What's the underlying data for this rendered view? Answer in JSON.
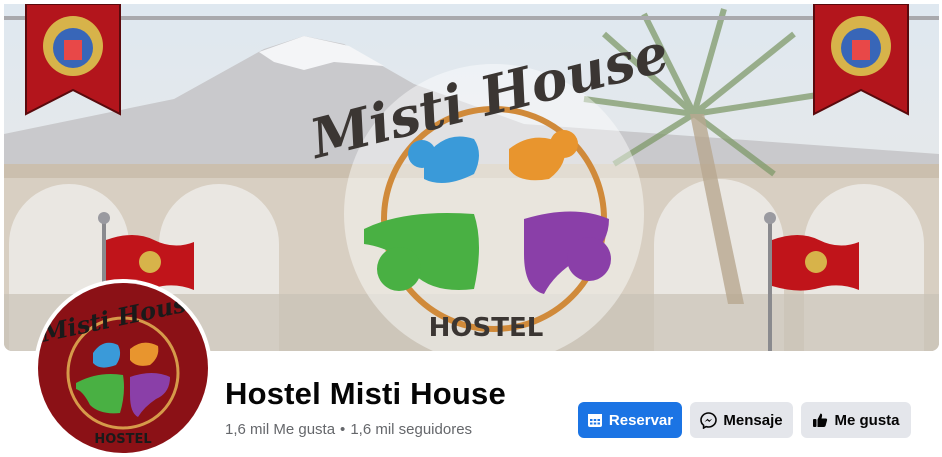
{
  "cover": {
    "logo_title": "Misti House",
    "logo_subtitle": "HOSTEL"
  },
  "page": {
    "name": "Hostel Misti House",
    "likes": "1,6 mil Me gusta",
    "separator": "•",
    "followers": "1,6 mil seguidores"
  },
  "actions": {
    "reserve_label": "Reservar",
    "message_label": "Mensaje",
    "like_label": "Me gusta"
  },
  "colors": {
    "accent": "#1b74e4",
    "secondary_button": "#e4e6eb",
    "logo_blue": "#3a9ad9",
    "logo_orange": "#e8952e",
    "logo_green": "#49b043",
    "logo_purple": "#8a3fa8",
    "profile_bg": "#8b1116"
  },
  "icons": {
    "reserve": "calendar-icon",
    "message": "messenger-icon",
    "like": "thumbs-up-icon"
  }
}
